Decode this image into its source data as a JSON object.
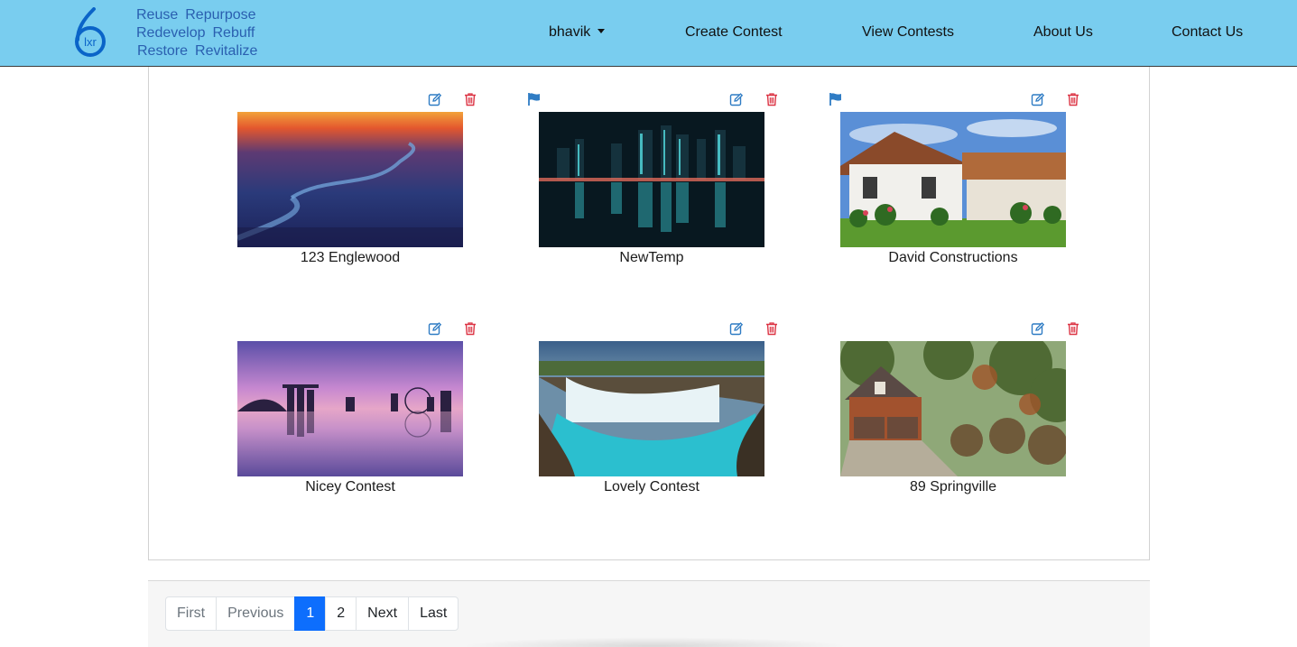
{
  "header": {
    "logo_alt": "6xr",
    "tagline": [
      [
        "Reuse",
        "Repurpose"
      ],
      [
        "Redevelop",
        "Rebuff"
      ],
      [
        "Restore",
        "Revitalize"
      ]
    ],
    "nav": {
      "user": "bhavik",
      "create": "Create Contest",
      "view": "View Contests",
      "about": "About Us",
      "contact": "Contact Us"
    }
  },
  "contests": [
    {
      "title": "123 Englewood",
      "flag": false
    },
    {
      "title": "NewTemp",
      "flag": true
    },
    {
      "title": "David Constructions",
      "flag": true
    },
    {
      "title": "Nicey Contest",
      "flag": false
    },
    {
      "title": "Lovely Contest",
      "flag": false
    },
    {
      "title": "89 Springville",
      "flag": false
    }
  ],
  "pagination": {
    "first": "First",
    "previous": "Previous",
    "pages": [
      "1",
      "2"
    ],
    "current_page": "1",
    "next": "Next",
    "last": "Last"
  },
  "colors": {
    "header_bg": "#79cdef",
    "tagline": "#2a5fb0",
    "edit_icon": "#2f7cc4",
    "trash_icon": "#dc3545",
    "flag_icon": "#2f7cc4",
    "active_page": "#0d6efd"
  },
  "icons": {
    "flag": "flag-icon",
    "edit": "edit-icon",
    "delete": "trash-icon"
  }
}
